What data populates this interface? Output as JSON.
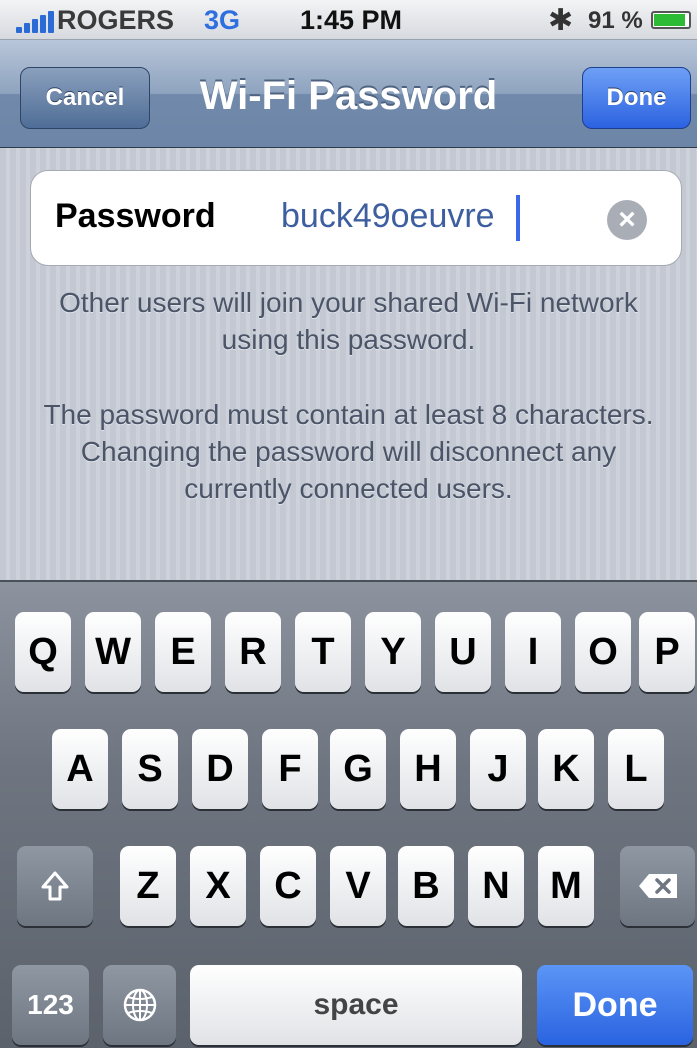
{
  "status_bar": {
    "carrier": "ROGERS",
    "network": "3G",
    "time": "1:45 PM",
    "bluetooth_icon": "bluetooth-icon",
    "battery_text": "91 %",
    "battery_level": 0.91,
    "battery_color": "#2dbb35"
  },
  "nav": {
    "title": "Wi-Fi Password",
    "cancel_label": "Cancel",
    "done_label": "Done"
  },
  "password_field": {
    "label": "Password",
    "value": "buck49oeuvre",
    "clear_icon": "clear-icon"
  },
  "info": {
    "line1": "Other users will join your shared Wi-Fi network using this password.",
    "line2": "The password must contain at least 8 characters. Changing the password will disconnect any currently connected users."
  },
  "keyboard": {
    "row1": [
      "Q",
      "W",
      "E",
      "R",
      "T",
      "Y",
      "U",
      "I",
      "O",
      "P"
    ],
    "row2": [
      "A",
      "S",
      "D",
      "F",
      "G",
      "H",
      "J",
      "K",
      "L"
    ],
    "row3": [
      "Z",
      "X",
      "C",
      "V",
      "B",
      "N",
      "M"
    ],
    "numbers_label": "123",
    "space_label": "space",
    "done_label": "Done",
    "shift_icon": "shift-icon",
    "delete_icon": "delete-icon",
    "globe_icon": "globe-icon",
    "accent_color": "#2a63e0"
  }
}
